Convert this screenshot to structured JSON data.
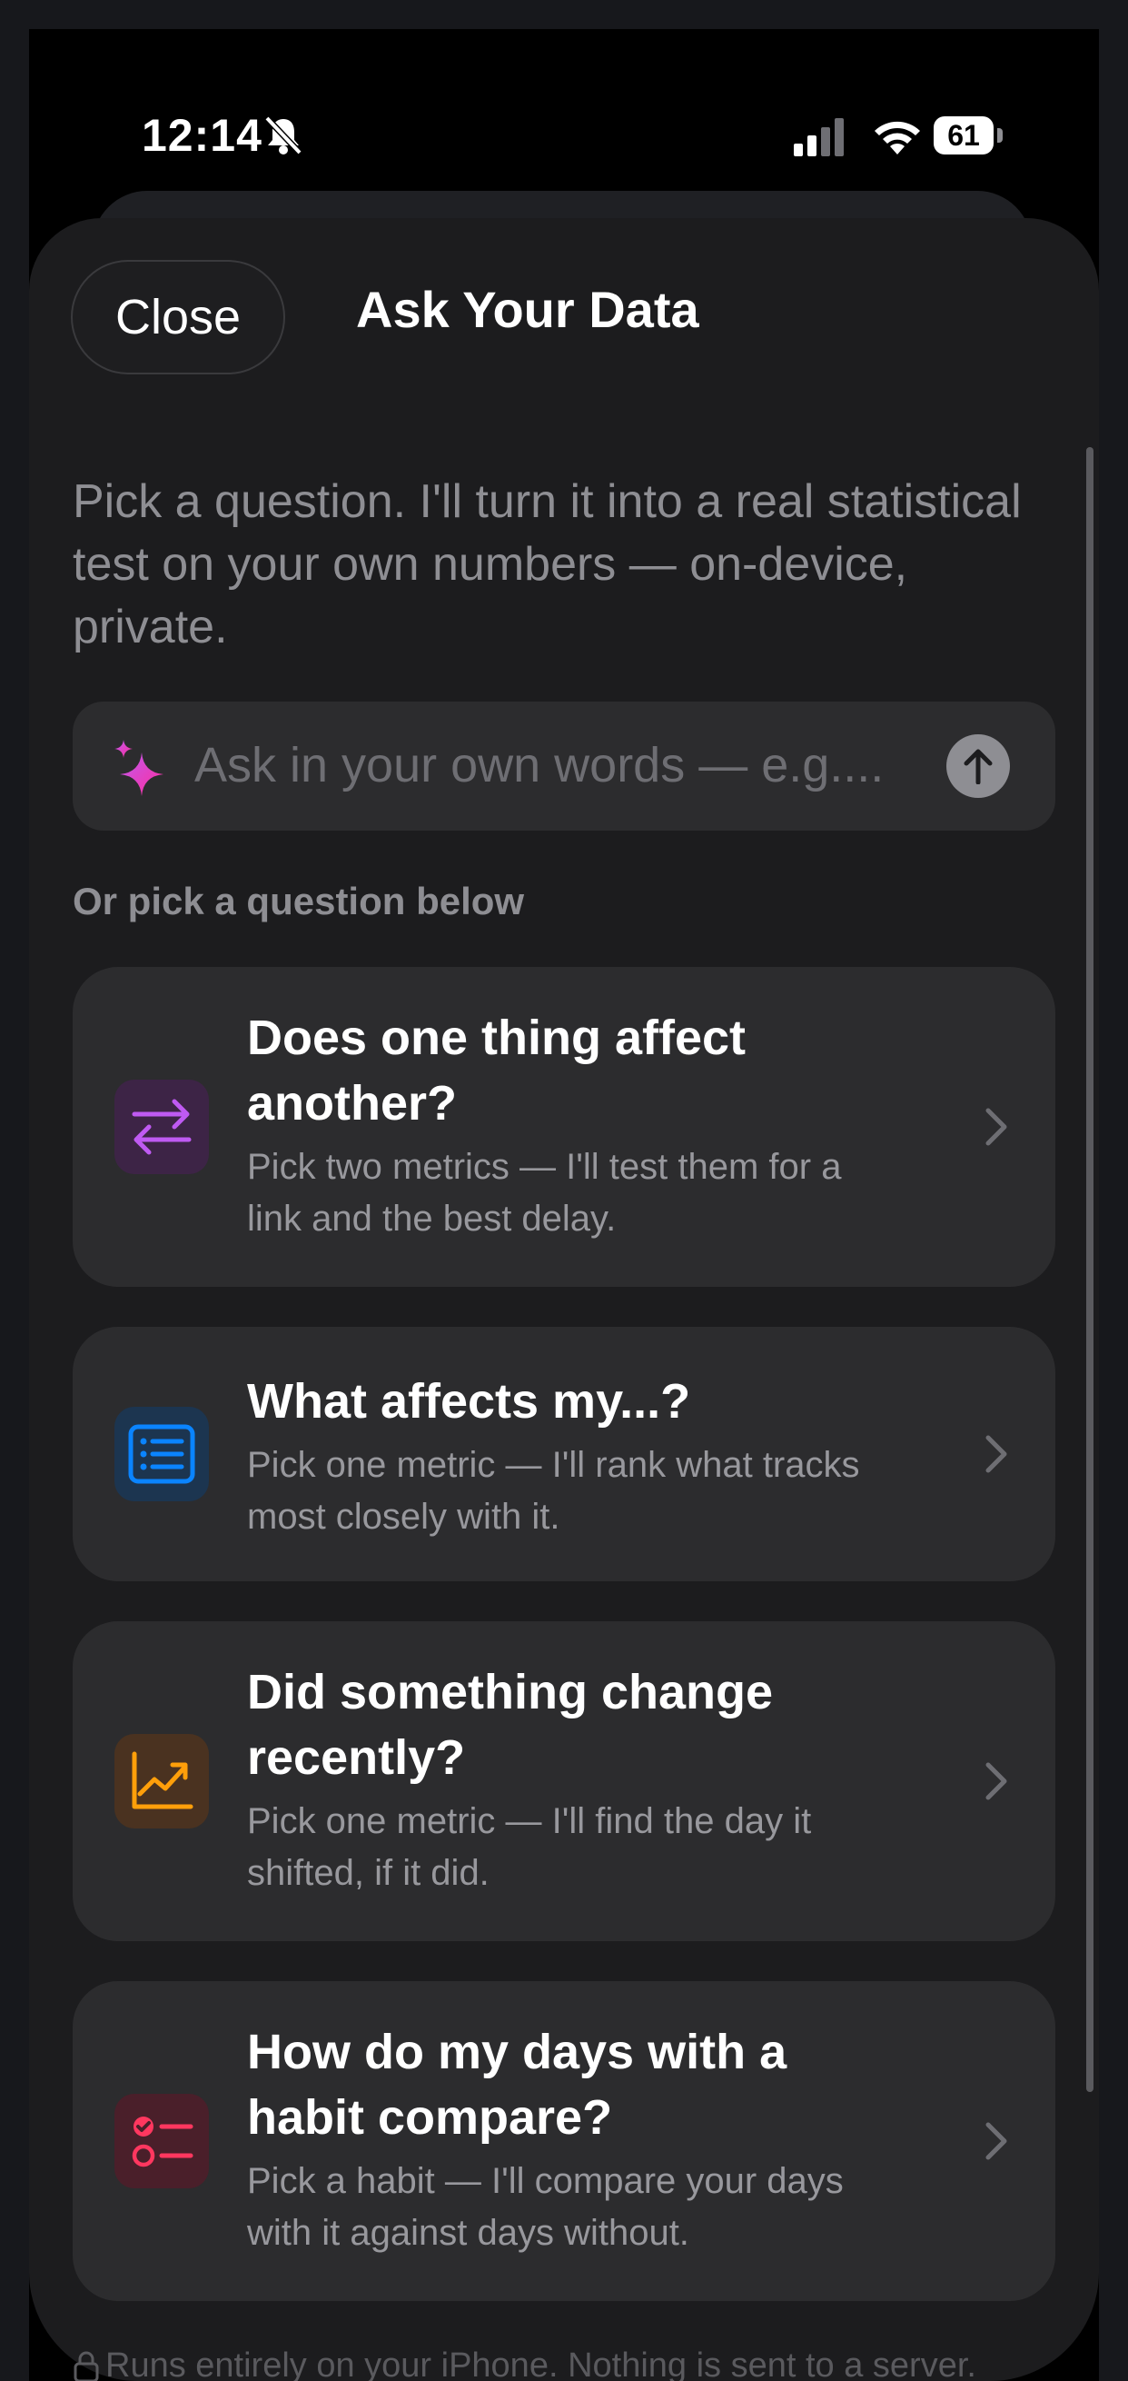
{
  "status_bar": {
    "time": "12:14",
    "battery": "61"
  },
  "header": {
    "close_label": "Close",
    "title": "Ask Your Data"
  },
  "intro": "Pick a question. I'll turn it into a real statistical test on your own numbers — on-device, private.",
  "ask": {
    "placeholder": "Ask in your own words — e.g...."
  },
  "section_label": "Or pick a question below",
  "cards": [
    {
      "title": "Does one thing affect another?",
      "description": "Pick two metrics — I'll test them for a link and the best delay.",
      "icon": "arrows-swap-icon",
      "color": "#bf5af2"
    },
    {
      "title": "What affects my...?",
      "description": "Pick one metric — I'll rank what tracks most closely with it.",
      "icon": "list-icon",
      "color": "#0a84ff"
    },
    {
      "title": "Did something change recently?",
      "description": "Pick one metric — I'll find the day it shifted, if it did.",
      "icon": "trend-chart-icon",
      "color": "#ff9f0a"
    },
    {
      "title": "How do my days with a habit compare?",
      "description": "Pick a habit — I'll compare your days with it against days without.",
      "icon": "checklist-icon",
      "color": "#ff375f"
    }
  ],
  "footer": "Runs entirely on your iPhone. Nothing is sent to a server."
}
